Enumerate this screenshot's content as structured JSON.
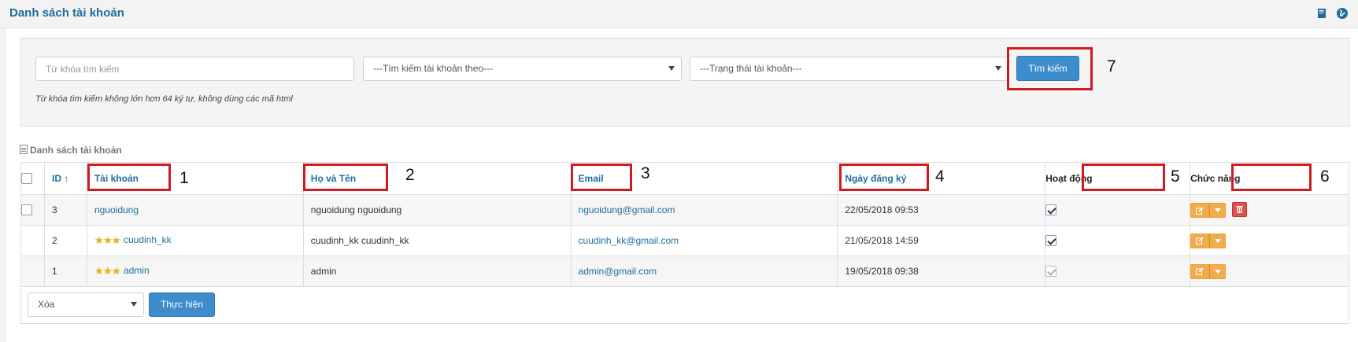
{
  "header": {
    "title": "Danh sách tài khoản",
    "book_icon": "book-icon",
    "globe_icon": "globe-icon"
  },
  "search": {
    "keyword_placeholder": "Từ khóa tìm kiếm",
    "search_by": "---Tìm kiếm tài khoản theo---",
    "status": "---Trạng thái tài khoản---",
    "button": "Tìm kiếm",
    "hint": "Từ khóa tìm kiếm không lớn hơn 64 ký tự, không dùng các mã html"
  },
  "section_label": "Danh sách tài khoản",
  "table": {
    "headers": {
      "id": "ID ↑",
      "account": "Tài khoản",
      "name": "Họ và Tên",
      "email": "Email",
      "date": "Ngày đăng ký",
      "active": "Hoạt động",
      "actions": "Chức năng"
    },
    "rows": [
      {
        "id": "3",
        "account": "nguoidung",
        "name": "nguoidung nguoidung",
        "email": "nguoidung@gmail.com",
        "date": "22/05/2018 09:53",
        "active": true
      },
      {
        "id": "2",
        "account": "cuudinh_kk",
        "name": "cuudinh_kk cuudinh_kk",
        "email": "cuudinh_kk@gmail.com",
        "date": "21/05/2018 14:59",
        "active": true
      },
      {
        "id": "1",
        "account": "admin",
        "name": "admin",
        "email": "admin@gmail.com",
        "date": "19/05/2018 09:38",
        "active": true
      }
    ]
  },
  "bulk": {
    "action": "Xóa",
    "button": "Thực hiện"
  },
  "annotations": [
    "1",
    "2",
    "3",
    "4",
    "5",
    "6",
    "7"
  ],
  "colors": {
    "accent": "#1e6d9b",
    "primary_button": "#3d8ccc",
    "warning": "#f0ad4e",
    "danger": "#d9534f",
    "annotation": "#d11b23"
  }
}
